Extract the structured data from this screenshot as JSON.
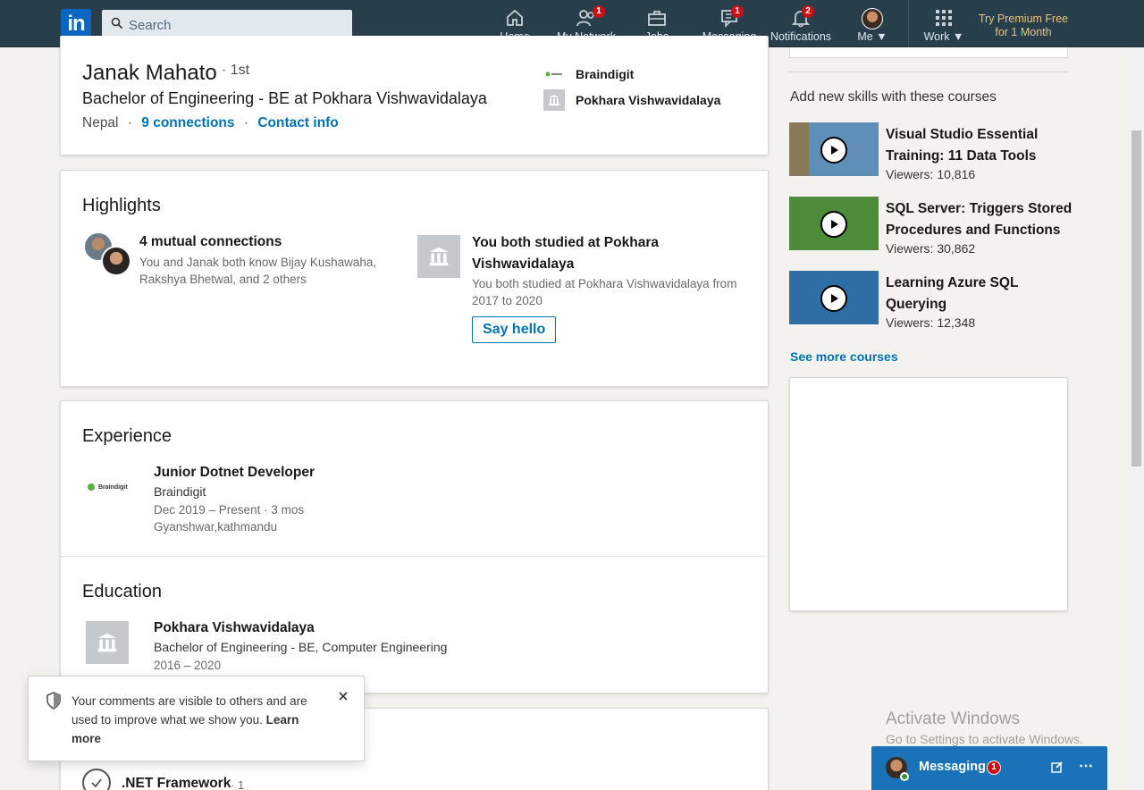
{
  "nav": {
    "search_placeholder": "Search",
    "items": [
      {
        "label": "Home",
        "badge": ""
      },
      {
        "label": "My Network",
        "badge": "1"
      },
      {
        "label": "Jobs",
        "badge": ""
      },
      {
        "label": "Messaging",
        "badge": "1"
      },
      {
        "label": "Notifications",
        "badge": "2"
      },
      {
        "label": "Me",
        "badge": ""
      },
      {
        "label": "Work",
        "badge": ""
      }
    ],
    "premium": "Try Premium Free for 1 Month"
  },
  "profile": {
    "name": "Janak Mahato",
    "degree": "· 1st",
    "headline": "Bachelor of Engineering - BE at Pokhara Vishwavidalaya",
    "location": "Nepal",
    "separator": "·",
    "connections": "9 connections",
    "contact": "Contact info",
    "company": "Braindigit",
    "school": "Pokhara Vishwavidalaya"
  },
  "highlights": {
    "title": "Highlights",
    "mutual_title": "4 mutual connections",
    "mutual_desc": "You and Janak both know Bijay Kushawaha, Rakshya Bhetwal, and 2 others",
    "studied_title": "You both studied at Pokhara Vishwavidalaya",
    "studied_desc": "You both studied at Pokhara Vishwavidalaya from 2017 to 2020",
    "say_hello": "Say hello"
  },
  "experience": {
    "title": "Experience",
    "logo_text": "Braindigit",
    "role": "Junior Dotnet Developer",
    "company": "Braindigit",
    "dates": "Dec 2019 – Present · 3 mos",
    "location": "Gyanshwar,kathmandu"
  },
  "education": {
    "title": "Education",
    "school": "Pokhara Vishwavidalaya",
    "degree": "Bachelor of Engineering - BE, Computer Engineering",
    "years": "2016 – 2020"
  },
  "skills": {
    "item": ".NET Framework",
    "count": "· 1"
  },
  "sidebar": {
    "courses_heading": "Add new skills with these courses",
    "courses": [
      {
        "title": "Visual Studio Essential Training: 11 Data Tools",
        "viewers": "Viewers: 10,816"
      },
      {
        "title": "SQL Server: Triggers Stored Procedures and Functions",
        "viewers": "Viewers: 30,862"
      },
      {
        "title": "Learning Azure SQL Querying",
        "viewers": "Viewers: 12,348"
      }
    ],
    "see_more": "See more courses"
  },
  "toast": {
    "text": "Your comments are visible to others and are used to improve what we show you.",
    "link": "Learn more"
  },
  "messaging": {
    "label": "Messaging",
    "badge": "1"
  },
  "watermark": {
    "title": "Activate Windows",
    "subtitle": "Go to Settings to activate Windows."
  }
}
